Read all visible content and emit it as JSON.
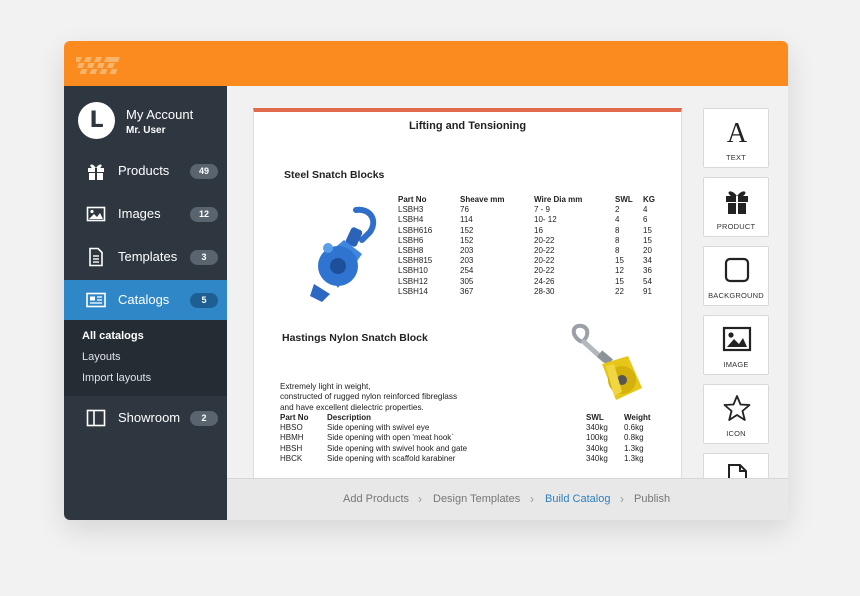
{
  "sidebar": {
    "account": {
      "initial": "L",
      "title": "My Account",
      "user": "Mr. User"
    },
    "items": [
      {
        "label": "Products",
        "count": "49",
        "icon": "gift-icon"
      },
      {
        "label": "Images",
        "count": "12",
        "icon": "image-icon"
      },
      {
        "label": "Templates",
        "count": "3",
        "icon": "document-icon"
      },
      {
        "label": "Catalogs",
        "count": "5",
        "icon": "catalog-icon"
      },
      {
        "label": "Showroom",
        "count": "2",
        "icon": "layout-icon"
      }
    ],
    "catalog_sub": [
      "All catalogs",
      "Layouts",
      "Import layouts"
    ]
  },
  "document": {
    "title": "Lifting and Tensioning",
    "section1": {
      "title": "Steel Snatch Blocks",
      "headers": [
        "Part No",
        "Sheave mm",
        "Wire Dia mm",
        "SWL",
        "KG"
      ],
      "part_no": [
        "LSBH3",
        "LSBH4",
        "LSBH616",
        "LSBH6",
        "LSBH8",
        "LSBH815",
        "LSBH10",
        "LSBH12",
        "LSBH14"
      ],
      "sheave": [
        "76",
        "114",
        "152",
        "152",
        "203",
        "203",
        "254",
        "305",
        "367"
      ],
      "wire": [
        "7 - 9",
        "10- 12",
        "16",
        "20-22",
        "20-22",
        "20-22",
        "20-22",
        "24-26",
        "28-30"
      ],
      "swl": [
        "2",
        "4",
        "8",
        "8",
        "8",
        "15",
        "12",
        "15",
        "22"
      ],
      "kg": [
        "4",
        "6",
        "15",
        "15",
        "20",
        "34",
        "36",
        "54",
        "91"
      ]
    },
    "section2": {
      "title": "Hastings Nylon Snatch Block",
      "description": [
        "Extremely light in weight,",
        "constructed of rugged nylon reinforced fibreglass",
        "and have excellent dielectric properties."
      ],
      "headers": [
        "Part No",
        "Description",
        "SWL",
        "Weight"
      ],
      "part_no": [
        "HBSO",
        "HBMH",
        "HBSH",
        "HBCK"
      ],
      "desc": [
        "Side opening  with swivel eye",
        "Side opening  with open 'meat hook`",
        "Side opening  with swivel hook and gate",
        "Side opening  with scaffold karabiner"
      ],
      "swl": [
        "340kg",
        "100kg",
        "340kg",
        "340kg"
      ],
      "weight": [
        "0.6kg",
        "0.8kg",
        "1.3kg",
        "1.3kg"
      ]
    }
  },
  "tools": [
    {
      "label": "TEXT",
      "icon": "text-icon"
    },
    {
      "label": "PRODUCT",
      "icon": "gift-icon"
    },
    {
      "label": "BACKGROUND",
      "icon": "square-icon"
    },
    {
      "label": "IMAGE",
      "icon": "image-icon"
    },
    {
      "label": "ICON",
      "icon": "star-icon"
    },
    {
      "label": "",
      "icon": "page-icon"
    }
  ],
  "steps": [
    "Add Products",
    "Design Templates",
    "Build Catalog",
    "Publish"
  ],
  "colors": {
    "topbar": "#fb8b1e",
    "sidebar": "#2e3740",
    "active": "#2f87c8",
    "accent_line": "#e06a4a"
  }
}
